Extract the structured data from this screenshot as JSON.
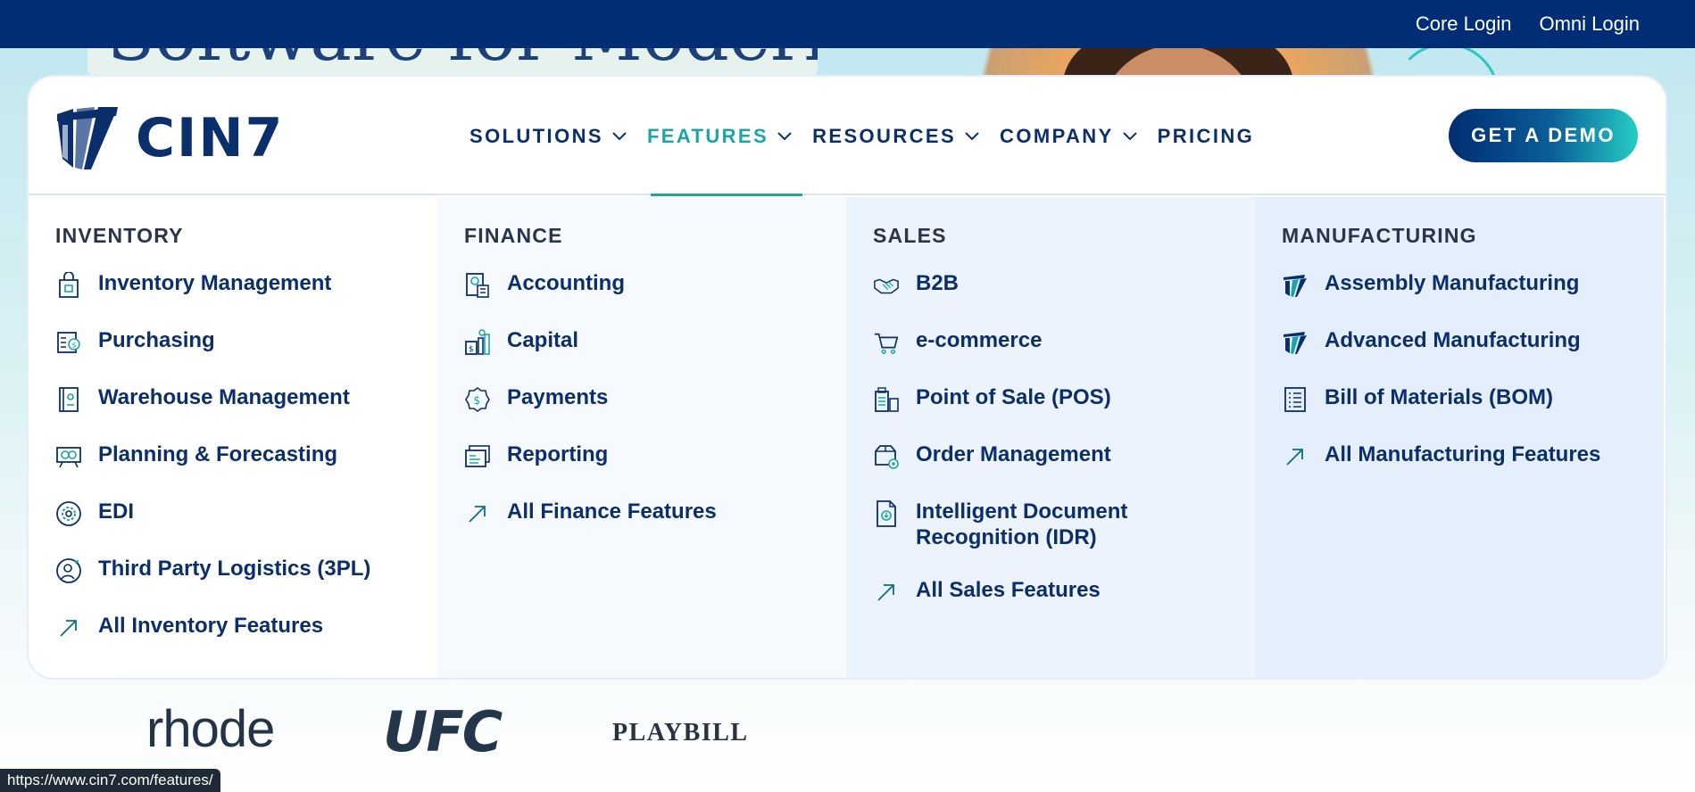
{
  "hero": {
    "title": "Software for Modern"
  },
  "topbar": {
    "links": [
      "Core Login",
      "Omni Login"
    ]
  },
  "logo": {
    "text": "CIN7"
  },
  "nav": {
    "items": [
      {
        "label": "SOLUTIONS",
        "has_dropdown": true,
        "active": false
      },
      {
        "label": "FEATURES",
        "has_dropdown": true,
        "active": true
      },
      {
        "label": "RESOURCES",
        "has_dropdown": true,
        "active": false
      },
      {
        "label": "COMPANY",
        "has_dropdown": true,
        "active": false
      },
      {
        "label": "PRICING",
        "has_dropdown": false,
        "active": false
      }
    ],
    "cta": "GET A DEMO"
  },
  "mega_menu": {
    "columns": [
      {
        "heading": "INVENTORY",
        "items": [
          {
            "label": "Inventory Management",
            "icon": "shopping-bag-icon"
          },
          {
            "label": "Purchasing",
            "icon": "purchase-order-icon"
          },
          {
            "label": "Warehouse Management",
            "icon": "warehouse-icon"
          },
          {
            "label": "Planning & Forecasting",
            "icon": "forecast-icon"
          },
          {
            "label": "EDI",
            "icon": "gear-icon"
          },
          {
            "label": "Third Party Logistics (3PL)",
            "icon": "user-circle-icon"
          },
          {
            "label": "All Inventory Features",
            "icon": "arrow-up-right-icon"
          }
        ]
      },
      {
        "heading": "FINANCE",
        "items": [
          {
            "label": "Accounting",
            "icon": "calculator-icon"
          },
          {
            "label": "Capital",
            "icon": "money-stack-icon"
          },
          {
            "label": "Payments",
            "icon": "dollar-badge-icon"
          },
          {
            "label": "Reporting",
            "icon": "report-icon"
          },
          {
            "label": "All Finance Features",
            "icon": "arrow-up-right-icon"
          }
        ]
      },
      {
        "heading": "SALES",
        "items": [
          {
            "label": "B2B",
            "icon": "handshake-icon"
          },
          {
            "label": "e-commerce",
            "icon": "cart-icon"
          },
          {
            "label": "Point of Sale (POS)",
            "icon": "pos-terminal-icon"
          },
          {
            "label": "Order Management",
            "icon": "order-box-icon"
          },
          {
            "label": "Intelligent Document Recognition (IDR)",
            "icon": "document-scan-icon"
          },
          {
            "label": "All Sales Features",
            "icon": "arrow-up-right-icon"
          }
        ]
      },
      {
        "heading": "MANUFACTURING",
        "items": [
          {
            "label": "Assembly Manufacturing",
            "icon": "cin7-mark-icon"
          },
          {
            "label": "Advanced Manufacturing",
            "icon": "cin7-mark-icon"
          },
          {
            "label": "Bill of Materials (BOM)",
            "icon": "list-document-icon"
          },
          {
            "label": "All Manufacturing Features",
            "icon": "arrow-up-right-icon"
          }
        ]
      }
    ]
  },
  "brands": [
    "rhode",
    "UFC",
    "PLAYBILL"
  ],
  "status_bar": {
    "url": "https://www.cin7.com/features/"
  },
  "colors": {
    "navy": "#002d74",
    "teal": "#1aa5a7",
    "text": "#0b2f6b"
  }
}
